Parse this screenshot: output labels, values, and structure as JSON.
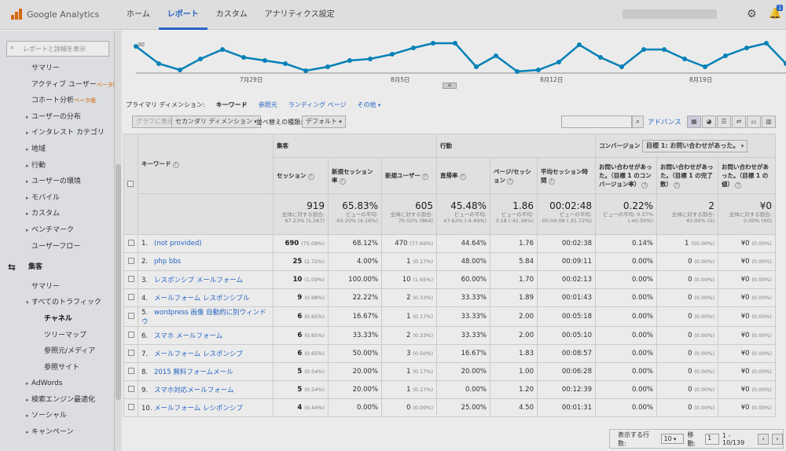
{
  "header": {
    "logo_text": "Google Analytics",
    "tabs": [
      "ホーム",
      "レポート",
      "カスタム",
      "アナリティクス設定"
    ],
    "active_tab": 1,
    "notif_count": "1"
  },
  "sidebar": {
    "search_placeholder": "レポートと詳細を表示",
    "items": [
      {
        "label": "サマリー",
        "kind": "l1"
      },
      {
        "label": "アクティブ ユーザー",
        "beta": "ベータ版",
        "kind": "l1"
      },
      {
        "label": "コホート分析",
        "beta": "ベータ版",
        "kind": "l1"
      },
      {
        "label": "ユーザーの分布",
        "kind": "caret"
      },
      {
        "label": "インタレスト カテゴリ",
        "kind": "caret"
      },
      {
        "label": "地域",
        "kind": "caret"
      },
      {
        "label": "行動",
        "kind": "caret"
      },
      {
        "label": "ユーザーの環境",
        "kind": "caret"
      },
      {
        "label": "モバイル",
        "kind": "caret"
      },
      {
        "label": "カスタム",
        "kind": "caret"
      },
      {
        "label": "ベンチマーク",
        "kind": "caret"
      },
      {
        "label": "ユーザーフロー",
        "kind": "l1"
      },
      {
        "label": "集客",
        "kind": "sec"
      },
      {
        "label": "サマリー",
        "kind": "l1"
      },
      {
        "label": "すべてのトラフィック",
        "kind": "open"
      },
      {
        "label": "チャネル",
        "kind": "act"
      },
      {
        "label": "ツリーマップ",
        "kind": "l3"
      },
      {
        "label": "参照元/メディア",
        "kind": "l3"
      },
      {
        "label": "参照サイト",
        "kind": "l3"
      },
      {
        "label": "AdWords",
        "kind": "caret"
      },
      {
        "label": "検索エンジン最適化",
        "kind": "caret"
      },
      {
        "label": "ソーシャル",
        "kind": "caret"
      },
      {
        "label": "キャンペーン",
        "kind": "caret"
      }
    ]
  },
  "chart": {
    "y_tick": "30",
    "x_ticks": [
      "7月29日",
      "8月5日",
      "8月12日",
      "8月19日"
    ],
    "line_color": "#058dc7"
  },
  "dimensions": {
    "label": "プライマリ ディメンション:",
    "current": "キーワード",
    "links": [
      "参照元",
      "ランディング ページ",
      "その他"
    ]
  },
  "controls": {
    "plot_rows": "グラフに表示",
    "secondary_dim": "セカンダリ ディメンション",
    "sort_type_label": "並べ替えの種類:",
    "sort_type_value": "デフォルト",
    "advanced": "アドバンス"
  },
  "table": {
    "keyword_header": "キーワード",
    "group_acq": "集客",
    "group_beh": "行動",
    "group_conv": "コンバージョン",
    "goal_select": "目標 1: お問い合わせがあった。",
    "columns": [
      "セッション",
      "新規セッション率",
      "新規ユーザー",
      "直帰率",
      "ページ/セッション",
      "平均セッション時間",
      "お問い合わせがあった。（目標 1 のコンバージョン率）",
      "お問い合わせがあった。（目標 1 の完了数）",
      "お問い合わせがあった。（目標 1 の値）"
    ],
    "totals": [
      {
        "big": "919",
        "sub": "全体に対する割合: 67.23% (1,367)"
      },
      {
        "big": "65.83%",
        "sub": "ビューの平均: 63.20% (4.16%)"
      },
      {
        "big": "605",
        "sub": "全体に対する割合: 70.02% (864)"
      },
      {
        "big": "45.48%",
        "sub": "ビューの平均: 47.62% (-4.49%)"
      },
      {
        "big": "1.86",
        "sub": "ビューの平均: 3.18 (-41.36%)"
      },
      {
        "big": "00:02:48",
        "sub": "ビューの平均: 00:04:06 (-31.72%)"
      },
      {
        "big": "0.22%",
        "sub": "ビューの平均: 0.37% (-40.50%)"
      },
      {
        "big": "2",
        "sub": "全体に対する割合: 40.00% (5)"
      },
      {
        "big": "¥0",
        "sub": "全体に対する割合: 0.00% (¥0)"
      }
    ],
    "rows": [
      {
        "n": "1.",
        "kw": "(not provided)",
        "s": "690",
        "sp": "(75.08%)",
        "nsr": "68.12%",
        "nu": "470",
        "nup": "(77.69%)",
        "br": "44.64%",
        "pps": "1.76",
        "ast": "00:02:38",
        "cr": "0.14%",
        "cmp": "1",
        "cmpp": "(50.00%)",
        "val": "¥0",
        "valp": "(0.00%)"
      },
      {
        "n": "2.",
        "kw": "php bbs",
        "s": "25",
        "sp": "(2.72%)",
        "nsr": "4.00%",
        "nu": "1",
        "nup": "(0.17%)",
        "br": "48.00%",
        "pps": "5.84",
        "ast": "00:09:11",
        "cr": "0.00%",
        "cmp": "0",
        "cmpp": "(0.00%)",
        "val": "¥0",
        "valp": "(0.00%)"
      },
      {
        "n": "3.",
        "kw": "レスポンシブ メールフォーム",
        "s": "10",
        "sp": "(1.09%)",
        "nsr": "100.00%",
        "nu": "10",
        "nup": "(1.65%)",
        "br": "60.00%",
        "pps": "1.70",
        "ast": "00:02:13",
        "cr": "0.00%",
        "cmp": "0",
        "cmpp": "(0.00%)",
        "val": "¥0",
        "valp": "(0.00%)"
      },
      {
        "n": "4.",
        "kw": "メールフォーム レスポンシブル",
        "s": "9",
        "sp": "(0.98%)",
        "nsr": "22.22%",
        "nu": "2",
        "nup": "(0.33%)",
        "br": "33.33%",
        "pps": "1.89",
        "ast": "00:01:43",
        "cr": "0.00%",
        "cmp": "0",
        "cmpp": "(0.00%)",
        "val": "¥0",
        "valp": "(0.00%)"
      },
      {
        "n": "5.",
        "kw": "wordpress 画像 自動的に別ウィンドウ",
        "s": "6",
        "sp": "(0.65%)",
        "nsr": "16.67%",
        "nu": "1",
        "nup": "(0.17%)",
        "br": "33.33%",
        "pps": "2.00",
        "ast": "00:05:18",
        "cr": "0.00%",
        "cmp": "0",
        "cmpp": "(0.00%)",
        "val": "¥0",
        "valp": "(0.00%)"
      },
      {
        "n": "6.",
        "kw": "スマホ メールフォーム",
        "s": "6",
        "sp": "(0.65%)",
        "nsr": "33.33%",
        "nu": "2",
        "nup": "(0.33%)",
        "br": "33.33%",
        "pps": "2.00",
        "ast": "00:05:10",
        "cr": "0.00%",
        "cmp": "0",
        "cmpp": "(0.00%)",
        "val": "¥0",
        "valp": "(0.00%)"
      },
      {
        "n": "7.",
        "kw": "メールフォーム レスポンシブ",
        "s": "6",
        "sp": "(0.65%)",
        "nsr": "50.00%",
        "nu": "3",
        "nup": "(0.50%)",
        "br": "16.67%",
        "pps": "1.83",
        "ast": "00:08:57",
        "cr": "0.00%",
        "cmp": "0",
        "cmpp": "(0.00%)",
        "val": "¥0",
        "valp": "(0.00%)"
      },
      {
        "n": "8.",
        "kw": "2015 無料フォームメール",
        "s": "5",
        "sp": "(0.54%)",
        "nsr": "20.00%",
        "nu": "1",
        "nup": "(0.17%)",
        "br": "20.00%",
        "pps": "1.00",
        "ast": "00:06:28",
        "cr": "0.00%",
        "cmp": "0",
        "cmpp": "(0.00%)",
        "val": "¥0",
        "valp": "(0.00%)"
      },
      {
        "n": "9.",
        "kw": "スマホ対応メールフォーム",
        "s": "5",
        "sp": "(0.54%)",
        "nsr": "20.00%",
        "nu": "1",
        "nup": "(0.17%)",
        "br": "0.00%",
        "pps": "1.20",
        "ast": "00:12:39",
        "cr": "0.00%",
        "cmp": "0",
        "cmpp": "(0.00%)",
        "val": "¥0",
        "valp": "(0.00%)"
      },
      {
        "n": "10.",
        "kw": "メールフォーム レシポンシブ",
        "s": "4",
        "sp": "(0.44%)",
        "nsr": "0.00%",
        "nu": "0",
        "nup": "(0.00%)",
        "br": "25.00%",
        "pps": "4.50",
        "ast": "00:01:31",
        "cr": "0.00%",
        "cmp": "0",
        "cmpp": "(0.00%)",
        "val": "¥0",
        "valp": "(0.00%)"
      }
    ]
  },
  "pager": {
    "rows_label": "表示する行数:",
    "rows_value": "10",
    "goto_label": "移動:",
    "goto_value": "1",
    "range": "1 - 10/139"
  }
}
